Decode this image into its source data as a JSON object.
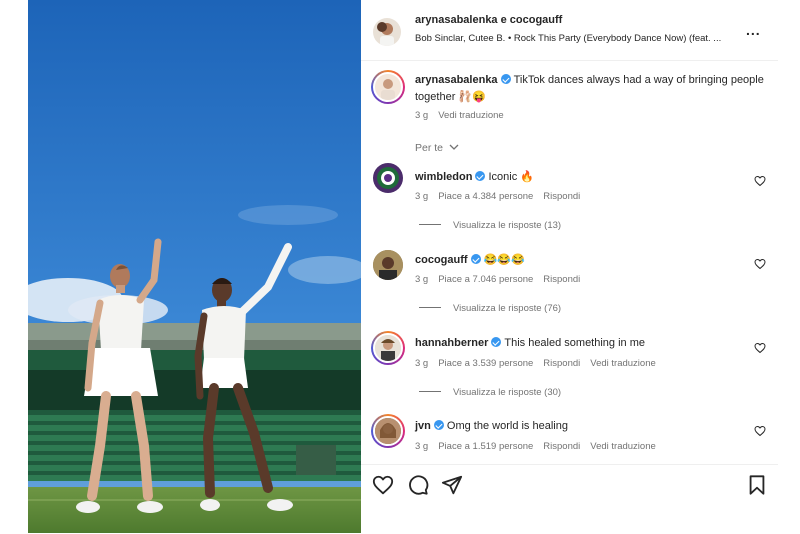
{
  "post": {
    "header": {
      "author": "arynasabalenka e cocogauff",
      "song": "Bob Sinclar, Cutee B. • Rock This Party (Everybody Dance Now) (feat. ...",
      "more_label": "..."
    },
    "caption": {
      "username": "arynasabalenka",
      "text": "TikTok dances always had a way of bringing people together 🩰😝",
      "time": "3 g",
      "translate": "Vedi traduzione"
    },
    "filter_label": "Per te",
    "comments": [
      {
        "username": "wimbledon",
        "text": "Iconic 🔥",
        "time": "3 g",
        "likes": "Piace a 4.384 persone",
        "reply": "Rispondi",
        "translate": "",
        "view_replies": "Visualizza le risposte (13)"
      },
      {
        "username": "cocogauff",
        "text": "😂😂😂",
        "time": "3 g",
        "likes": "Piace a 7.046 persone",
        "reply": "Rispondi",
        "translate": "",
        "view_replies": "Visualizza le risposte (76)"
      },
      {
        "username": "hannahberner",
        "text": "This healed something in me",
        "time": "3 g",
        "likes": "Piace a 3.539 persone",
        "reply": "Rispondi",
        "translate": "Vedi traduzione",
        "view_replies": "Visualizza le risposte (30)"
      },
      {
        "username": "jvn",
        "text": "Omg the world is healing",
        "time": "3 g",
        "likes": "Piace a 1.519 persone",
        "reply": "Rispondi",
        "translate": "Vedi traduzione",
        "view_replies": ""
      }
    ],
    "actions": [
      "heart-icon",
      "comment-icon",
      "share-icon",
      "bookmark-icon"
    ]
  },
  "colors": {
    "verified": "#3897f0",
    "sky": "#2f78c8",
    "grass": "#5f8a3a",
    "seats": "#2e7a52"
  }
}
